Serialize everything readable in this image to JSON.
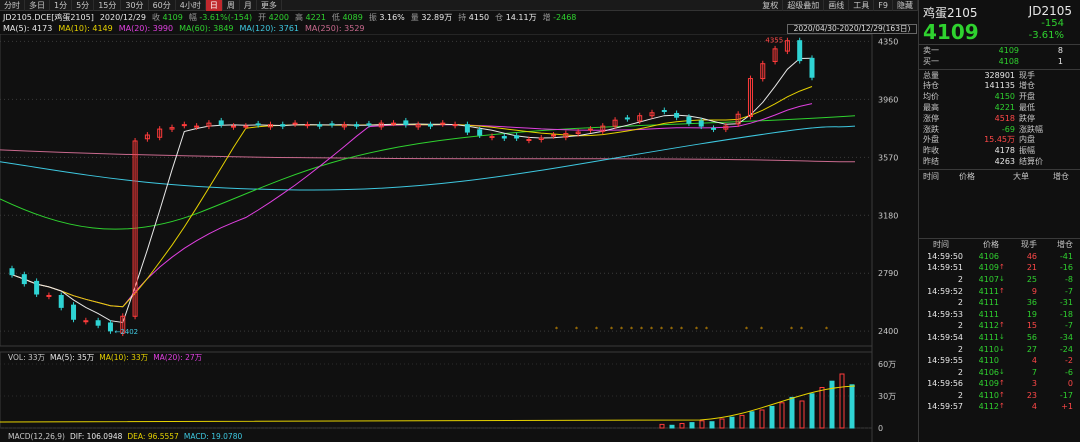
{
  "toolbar": {
    "left": [
      "分时",
      "多日",
      "1分",
      "5分",
      "15分",
      "30分",
      "60分",
      "4小时",
      "日",
      "周",
      "月",
      "更多"
    ],
    "active": "日",
    "right": [
      "复权",
      "超级叠加",
      "画线",
      "工具",
      "F9",
      "隐藏"
    ]
  },
  "info": {
    "symbol": "JD2105.DCE[鸡蛋2105]",
    "date": "2020/12/29",
    "close_label": "收",
    "close": "4109",
    "change_label": "幅",
    "change": "-3.61%(-154)",
    "open_label": "开",
    "open": "4200",
    "high_label": "高",
    "high": "4221",
    "low_label": "低",
    "low": "4089",
    "amp_label": "振",
    "amp": "3.16%",
    "vol_label": "量",
    "vol": "32.89万",
    "pos_label": "持",
    "pos": "4150",
    "amt_label": "仓",
    "amt": "14.11万",
    "inc_label": "增",
    "inc": "-2468"
  },
  "ma": {
    "ma5": "MA(5): 4173",
    "ma10": "MA(10): 4149",
    "ma20": "MA(20): 3990",
    "ma60": "MA(60): 3849",
    "ma120": "MA(120): 3761",
    "ma250": "MA(250): 3529"
  },
  "range_label": "2020/04/30-2020/12/29(163日)",
  "price_axis": [
    "4350",
    "3960",
    "3570",
    "3180",
    "2790",
    "2400"
  ],
  "annotations": {
    "high": "4355",
    "low": "2402"
  },
  "vol_info": {
    "vol": "VOL: 33万",
    "ma5": "MA(5): 35万",
    "ma10": "MA(10): 33万",
    "ma20": "MA(20): 27万"
  },
  "vol_axis": [
    "60万",
    "30万",
    "0"
  ],
  "macd_info": {
    "title": "MACD(12,26,9)",
    "dif": "DIF: 106.0948",
    "dea": "DEA: 96.5557",
    "macd": "MACD: 19.0780"
  },
  "colors": {
    "up": "#ff3b3b",
    "down": "#2fd4d4",
    "ma5": "#e8e8e8",
    "ma10": "#e6d200",
    "ma20": "#e040e0",
    "ma60": "#2fd22f",
    "ma120": "#3ec8e0",
    "ma250": "#c96a8e"
  },
  "quote": {
    "name": "鸡蛋2105",
    "code": "JD2105",
    "price": "4109",
    "change": "-154",
    "pct": "-3.61%",
    "book": [
      {
        "label": "卖一",
        "price": "4109",
        "qty": "8"
      },
      {
        "label": "买一",
        "price": "4108",
        "qty": "1"
      }
    ],
    "stats": [
      {
        "l1": "总量",
        "v1": "328901",
        "l2": "现手",
        "v2": "",
        "c1": "white"
      },
      {
        "l1": "持仓",
        "v1": "141135",
        "l2": "增仓",
        "v2": "",
        "c1": "white"
      },
      {
        "l1": "均价",
        "v1": "4150",
        "l2": "开盘",
        "v2": "",
        "c1": "green"
      },
      {
        "l1": "最高",
        "v1": "4221",
        "l2": "最低",
        "v2": "",
        "c1": "green"
      },
      {
        "l1": "涨停",
        "v1": "4518",
        "l2": "跌停",
        "v2": "",
        "c1": "red"
      },
      {
        "l1": "涨跌",
        "v1": "-69",
        "l2": "涨跌幅",
        "v2": "",
        "c1": "green"
      },
      {
        "l1": "外盘",
        "v1": "15.45万",
        "l2": "内盘",
        "v2": "",
        "c1": "red"
      },
      {
        "l1": "昨收",
        "v1": "4178",
        "l2": "振幅",
        "v2": "",
        "c1": "white"
      },
      {
        "l1": "昨结",
        "v1": "4263",
        "l2": "结算价",
        "v2": "",
        "c1": "white"
      }
    ],
    "tabs": [
      "时间",
      "价格",
      "大单",
      "增仓"
    ],
    "trades_header": [
      "时间",
      "价格",
      "现手",
      "增仓"
    ],
    "trades": [
      {
        "t": "14:59:50",
        "p": "4106",
        "a": "",
        "q": "46",
        "d": "-41",
        "pc": "green",
        "qc": "red",
        "dc": "green"
      },
      {
        "t": "14:59:51",
        "p": "4109",
        "a": "↑",
        "q": "21",
        "d": "-16",
        "pc": "green",
        "qc": "red",
        "dc": "green"
      },
      {
        "t": "2",
        "p": "4107",
        "a": "↓",
        "q": "25",
        "d": "-8",
        "pc": "green",
        "qc": "green",
        "dc": "green"
      },
      {
        "t": "14:59:52",
        "p": "4111",
        "a": "↑",
        "q": "9",
        "d": "-7",
        "pc": "green",
        "qc": "red",
        "dc": "green"
      },
      {
        "t": "2",
        "p": "4111",
        "a": "",
        "q": "36",
        "d": "-31",
        "pc": "green",
        "qc": "green",
        "dc": "green"
      },
      {
        "t": "14:59:53",
        "p": "4111",
        "a": "",
        "q": "19",
        "d": "-18",
        "pc": "green",
        "qc": "green",
        "dc": "green"
      },
      {
        "t": "2",
        "p": "4112",
        "a": "↑",
        "q": "15",
        "d": "-7",
        "pc": "green",
        "qc": "red",
        "dc": "green"
      },
      {
        "t": "14:59:54",
        "p": "4111",
        "a": "↓",
        "q": "56",
        "d": "-34",
        "pc": "green",
        "qc": "green",
        "dc": "green"
      },
      {
        "t": "2",
        "p": "4110",
        "a": "↓",
        "q": "27",
        "d": "-24",
        "pc": "green",
        "qc": "green",
        "dc": "green"
      },
      {
        "t": "14:59:55",
        "p": "4110",
        "a": "",
        "q": "4",
        "d": "-2",
        "pc": "green",
        "qc": "red",
        "dc": "red"
      },
      {
        "t": "2",
        "p": "4106",
        "a": "↓",
        "q": "7",
        "d": "-6",
        "pc": "green",
        "qc": "green",
        "dc": "green"
      },
      {
        "t": "14:59:56",
        "p": "4109",
        "a": "↑",
        "q": "3",
        "d": "0",
        "pc": "green",
        "qc": "red",
        "dc": "red"
      },
      {
        "t": "2",
        "p": "4110",
        "a": "↑",
        "q": "23",
        "d": "-17",
        "pc": "green",
        "qc": "red",
        "dc": "green"
      },
      {
        "t": "14:59:57",
        "p": "4112",
        "a": "↑",
        "q": "4",
        "d": "+1",
        "pc": "green",
        "qc": "red",
        "dc": "red"
      }
    ]
  },
  "chart_data": {
    "type": "candlestick",
    "title": "JD2105.DCE[鸡蛋2105]",
    "period": "2020/04/30-2020/12/29",
    "ylim": [
      2300,
      4400
    ],
    "y_ticks": [
      2400,
      2790,
      3180,
      3570,
      3960,
      4350
    ],
    "candles_approx_close": [
      2780,
      2720,
      2650,
      2640,
      2560,
      2480,
      2470,
      2440,
      2402,
      2500,
      3680,
      3720,
      3760,
      3770,
      3790,
      3780,
      3800,
      3790,
      3780,
      3780,
      3790,
      3790,
      3780,
      3800,
      3790,
      3780,
      3790,
      3790,
      3780,
      3790,
      3800,
      3800,
      3790,
      3790,
      3780,
      3800,
      3790,
      3740,
      3720,
      3710,
      3700,
      3700,
      3690,
      3700,
      3720,
      3730,
      3740,
      3760,
      3780,
      3820,
      3830,
      3850,
      3870,
      3880,
      3840,
      3800,
      3780,
      3760,
      3780,
      3860,
      4100,
      4200,
      4300,
      4355,
      4221,
      4109
    ],
    "ma_lines": {
      "MA5": 4173,
      "MA10": 4149,
      "MA20": 3990,
      "MA60": 3849,
      "MA120": 3761,
      "MA250": 3529
    },
    "volume_ylim": [
      0,
      600000
    ],
    "volume_ticks": [
      "0",
      "30万",
      "60万"
    ],
    "macd": {
      "dif": 106.0948,
      "dea": 96.5557,
      "macd": 19.078
    }
  }
}
